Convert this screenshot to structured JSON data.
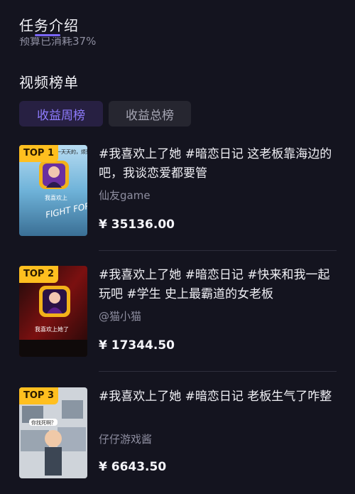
{
  "header": {
    "title": "任务介绍",
    "cutoff_text": "预算已消耗37%"
  },
  "section": {
    "title": "视频榜单"
  },
  "segments": {
    "weekly": "收益周榜",
    "total": "收益总榜",
    "selected": "收益周榜"
  },
  "colors": {
    "background": "#14141f",
    "accent": "#7a66f5",
    "badge": "#ffbf1f"
  },
  "items": [
    {
      "rank": "TOP 1",
      "title": "#我喜欢上了她 #暗恋日记 这老板靠海边的吧，我谈恋爱都要管",
      "author": "仙友game",
      "amount": "¥ 35136.00",
      "thumb_caption": "我喜欢上",
      "thumb_overlay": "FIGHT FOR YOU RIGHT!",
      "thumb_top_text": "一天天的，烦死了"
    },
    {
      "rank": "TOP 2",
      "title": "#我喜欢上了她 #暗恋日记 #快来和我一起玩吧 #学生 史上最霸道的女老板",
      "author": "@猫小猫",
      "amount": "¥ 17344.50",
      "thumb_caption": "我喜欢上她了"
    },
    {
      "rank": "TOP 3",
      "title": "#我喜欢上了她 #暗恋日记 老板生气了咋整",
      "author": "仔仔游戏酱",
      "amount": "¥ 6643.50",
      "thumb_caption": "你找死啊？"
    }
  ]
}
